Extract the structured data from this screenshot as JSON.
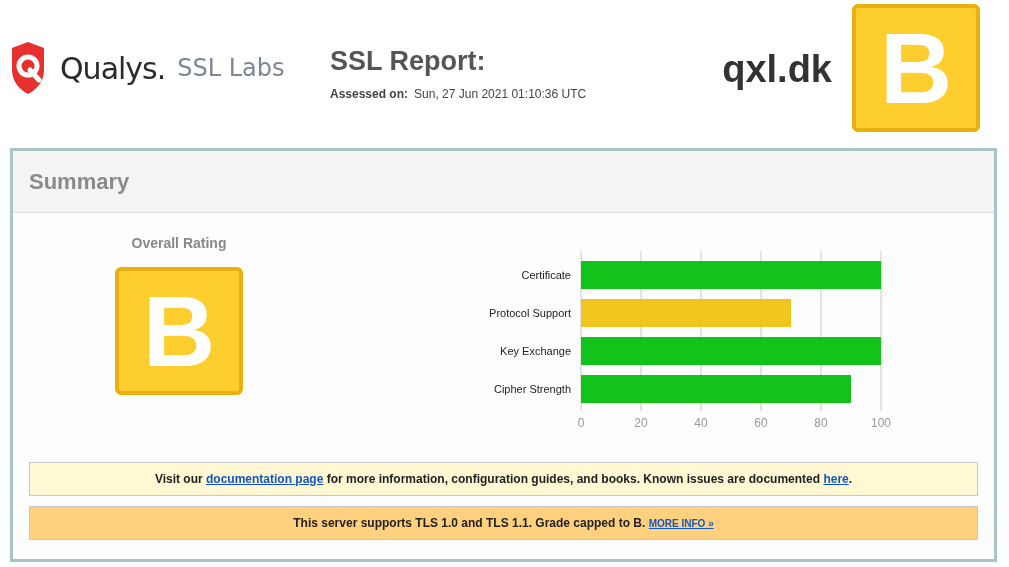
{
  "logo": {
    "brand": "Qualys.",
    "product": "SSL Labs"
  },
  "report": {
    "title": "SSL Report:",
    "assessed_label": "Assessed on:",
    "assessed_value": "Sun, 27 Jun 2021 01:10:36 UTC"
  },
  "host": "qxl.dk",
  "grade": "B",
  "summary": {
    "title": "Summary",
    "rating_label": "Overall Rating",
    "grade": "B",
    "chart_data": {
      "type": "bar",
      "orientation": "horizontal",
      "grid": true,
      "categories": [
        "Certificate",
        "Protocol Support",
        "Key Exchange",
        "Cipher Strength"
      ],
      "values": [
        100,
        70,
        100,
        90
      ],
      "colors": [
        "#12c41a",
        "#f0c51e",
        "#12c41a",
        "#12c41a"
      ],
      "xlim": [
        0,
        100
      ],
      "xticks": [
        0,
        20,
        40,
        60,
        80,
        100
      ]
    },
    "notices": [
      {
        "kind": "info",
        "parts": [
          {
            "text": "Visit our "
          },
          {
            "link": "documentation page"
          },
          {
            "text": " for more information, configuration guides, and books. Known issues are documented "
          },
          {
            "link": "here"
          },
          {
            "text": "."
          }
        ]
      },
      {
        "kind": "warning",
        "parts": [
          {
            "text": "This server supports TLS 1.0 and TLS 1.1. Grade capped to B. "
          },
          {
            "link": "MORE INFO »"
          }
        ]
      }
    ]
  }
}
